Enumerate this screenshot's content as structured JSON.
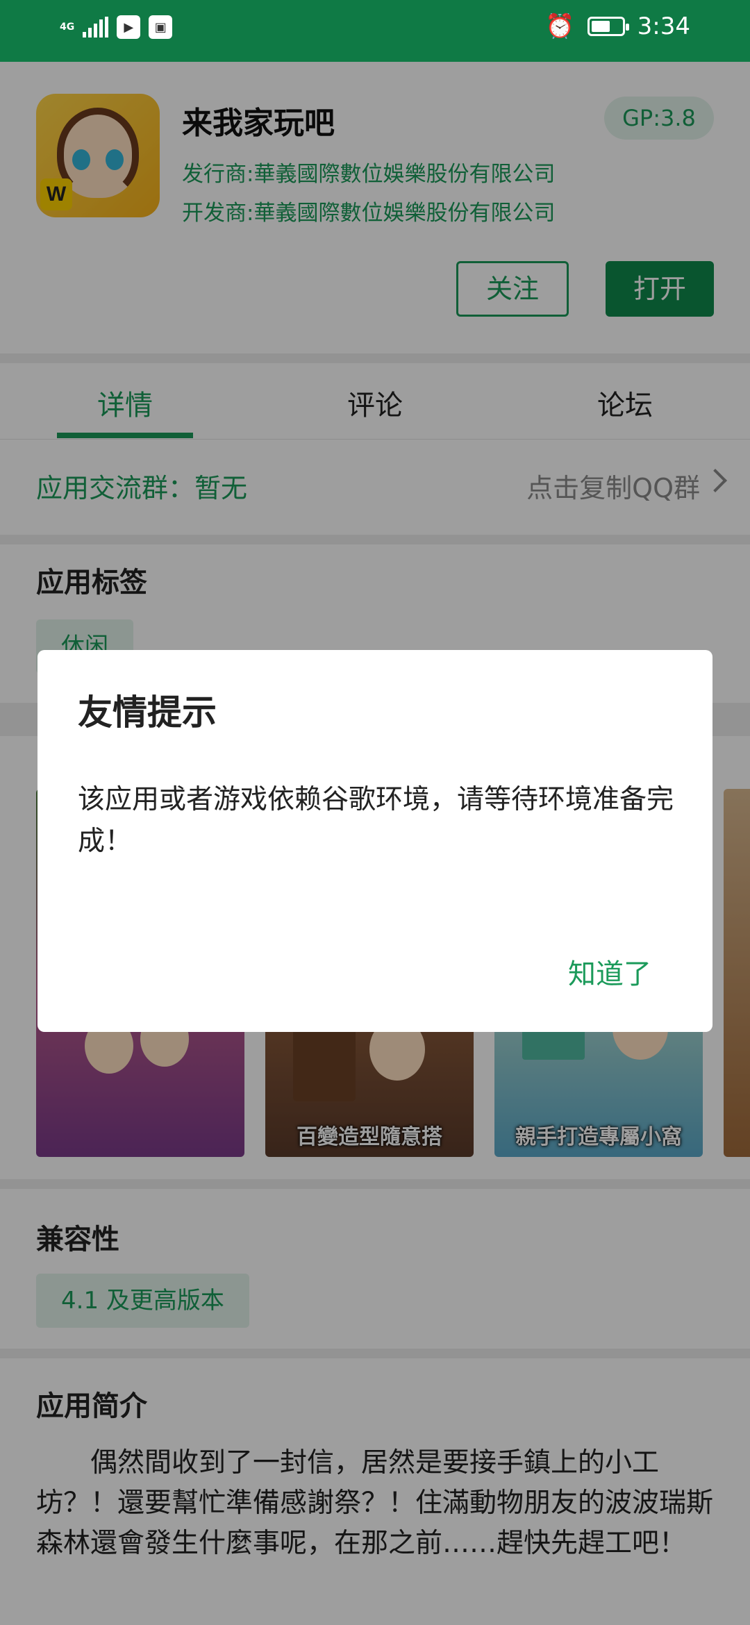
{
  "status_bar": {
    "network": "4G",
    "time": "3:34",
    "colors": {
      "background": "#0f7a45"
    }
  },
  "app": {
    "title": "来我家玩吧",
    "gp_score": "GP:3.8",
    "publisher": "发行商:華義國際數位娛樂股份有限公司",
    "developer": "开发商:華義國際數位娛樂股份有限公司",
    "follow_label": "关注",
    "open_label": "打开"
  },
  "tabs": [
    {
      "label": "详情",
      "active": true
    },
    {
      "label": "评论",
      "active": false
    },
    {
      "label": "论坛",
      "active": false
    }
  ],
  "qq_group": {
    "label": "应用交流群：暂无",
    "copy_label": "点击复制QQ群"
  },
  "tags_section": {
    "title": "应用标签",
    "tags": [
      "休闲"
    ]
  },
  "screenshots": [
    {
      "caption": ""
    },
    {
      "caption": "百變造型隨意搭"
    },
    {
      "caption": "親手打造專屬小窩"
    },
    {
      "caption": ""
    }
  ],
  "compatibility": {
    "title": "兼容性",
    "value": "4.1 及更高版本"
  },
  "intro": {
    "title": "应用简介",
    "text": "偶然間收到了一封信，居然是要接手鎮上的小工坊？！還要幫忙準備感謝祭？！住滿動物朋友的波波瑞斯森林還會發生什麼事呢，在那之前……趕快先趕工吧！"
  },
  "dialog": {
    "title": "友情提示",
    "message": "该应用或者游戏依赖谷歌环境，请等待环境准备完成！",
    "ok_label": "知道了"
  },
  "colors": {
    "accent": "#1b9a5a",
    "accent_dark": "#0f8a4d",
    "tag_bg": "#e3f3ea"
  }
}
